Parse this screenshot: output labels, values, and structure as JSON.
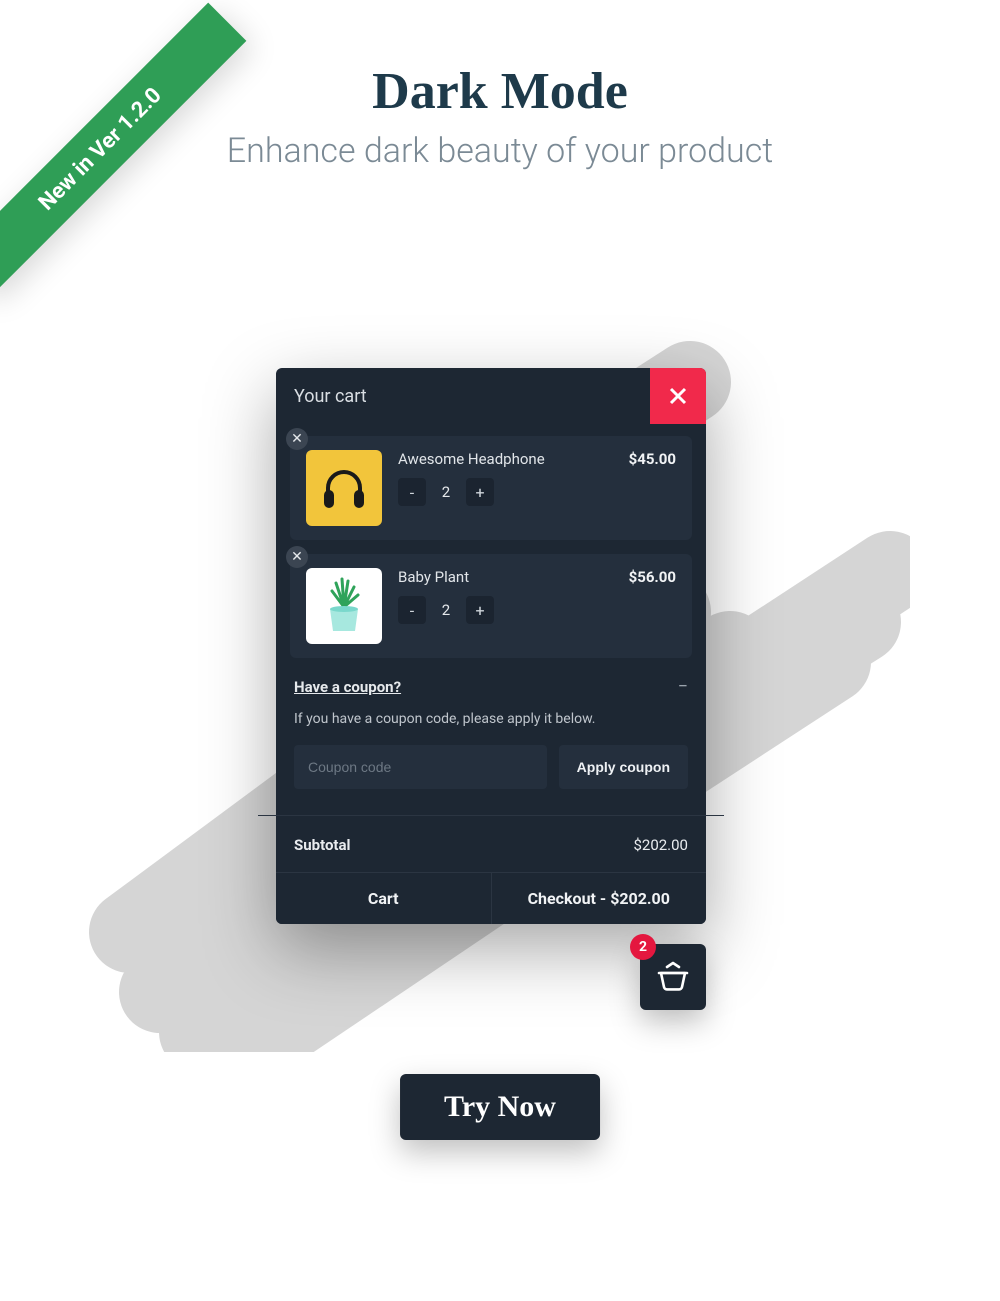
{
  "ribbon": {
    "label": "New in Ver 1.2.0"
  },
  "page": {
    "title": "Dark Mode",
    "subtitle": "Enhance dark beauty of your product"
  },
  "cart": {
    "header_title": "Your cart",
    "items": [
      {
        "name": "Awesome Headphone",
        "price": "$45.00",
        "qty": "2"
      },
      {
        "name": "Baby Plant",
        "price": "$56.00",
        "qty": "2"
      }
    ],
    "coupon": {
      "toggle_label": "Have a coupon?",
      "hint": "If you have a coupon code, please apply it below.",
      "placeholder": "Coupon code",
      "apply_label": "Apply coupon"
    },
    "subtotal": {
      "label": "Subtotal",
      "value": "$202.00"
    },
    "footer": {
      "cart_label": "Cart",
      "checkout_label": "Checkout - $202.00"
    }
  },
  "fab": {
    "badge": "2"
  },
  "cta": {
    "label": "Try Now"
  }
}
